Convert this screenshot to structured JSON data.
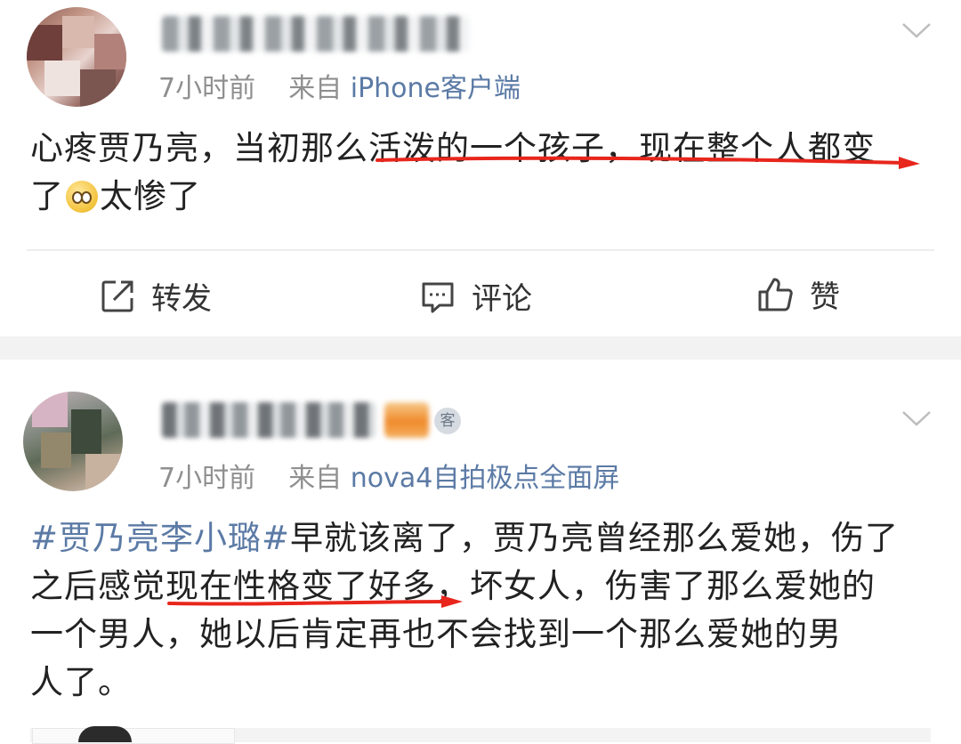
{
  "post1": {
    "time": "7小时前",
    "source_prefix": "来自",
    "source": "iPhone客户端",
    "text_line1": "心疼贾乃亮，当初那么活泼的一个孩子，现在整个人都变",
    "text_line2_a": "了",
    "text_line2_b": "太惨了",
    "emoji_icon": "worried-face-emoji",
    "actions": {
      "repost": "转发",
      "comment": "评论",
      "like": "赞"
    }
  },
  "post2": {
    "time": "7小时前",
    "source_prefix": "来自",
    "source": "nova4自拍极点全面屏",
    "vip_badge": "客",
    "hashtag": "#贾乃亮李小璐#",
    "line1_rest": "早就该离了，贾乃亮曾经那么爱她，伤了",
    "line2": "之后感觉现在性格变了好多，坏女人，伤害了那么爱她的",
    "line3": "一个男人，她以后肯定再也不会找到一个那么爱她的男",
    "line4": "人了。"
  },
  "colors": {
    "link_blue": "#5b7aa5",
    "meta_gray": "#8f8f8f",
    "underline_red": "#e8261c",
    "separator": "#f2f2f2"
  }
}
